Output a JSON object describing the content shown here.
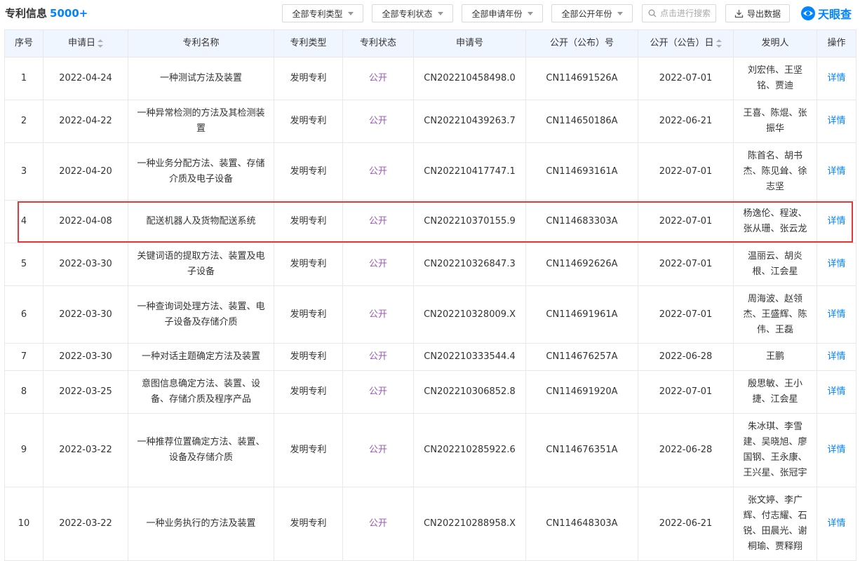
{
  "header": {
    "title": "专利信息",
    "count": "5000+",
    "filters": [
      {
        "label": "全部专利类型",
        "name": "filter-patent-type"
      },
      {
        "label": "全部专利状态",
        "name": "filter-patent-status"
      },
      {
        "label": "全部申请年份",
        "name": "filter-application-year"
      },
      {
        "label": "全部公开年份",
        "name": "filter-publication-year"
      }
    ],
    "search_placeholder": "点击进行搜索",
    "export_label": "导出数据",
    "logo_text": "天眼查"
  },
  "table": {
    "columns": [
      "序号",
      "申请日",
      "专利名称",
      "专利类型",
      "专利状态",
      "申请号",
      "公开（公布）号",
      "公开（公告）日",
      "发明人",
      "操作"
    ],
    "rows": [
      {
        "index": "1",
        "date": "2022-04-24",
        "name": "一种测试方法及装置",
        "type": "发明专利",
        "status": "公开",
        "app_no": "CN202210458498.0",
        "pub_no": "CN114691526A",
        "pub_date": "2022-07-01",
        "inventors": "刘宏伟、王坚铭、贾迪",
        "action": "详情"
      },
      {
        "index": "2",
        "date": "2022-04-22",
        "name": "一种异常检测的方法及其检测装置",
        "type": "发明专利",
        "status": "公开",
        "app_no": "CN202210439263.7",
        "pub_no": "CN114650186A",
        "pub_date": "2022-06-21",
        "inventors": "王喜、陈焜、张振华",
        "action": "详情"
      },
      {
        "index": "3",
        "date": "2022-04-20",
        "name": "一种业务分配方法、装置、存储介质及电子设备",
        "type": "发明专利",
        "status": "公开",
        "app_no": "CN202210417747.1",
        "pub_no": "CN114693161A",
        "pub_date": "2022-07-01",
        "inventors": "陈首名、胡书杰、陈见耸、徐志坚",
        "action": "详情"
      },
      {
        "index": "4",
        "date": "2022-04-08",
        "name": "配送机器人及货物配送系统",
        "type": "发明专利",
        "status": "公开",
        "app_no": "CN202210370155.9",
        "pub_no": "CN114683303A",
        "pub_date": "2022-07-01",
        "inventors": "杨逸伦、程波、张从珊、张云龙",
        "action": "详情"
      },
      {
        "index": "5",
        "date": "2022-03-30",
        "name": "关键词语的提取方法、装置及电子设备",
        "type": "发明专利",
        "status": "公开",
        "app_no": "CN202210326847.3",
        "pub_no": "CN114692626A",
        "pub_date": "2022-07-01",
        "inventors": "温丽云、胡炎根、江会星",
        "action": "详情"
      },
      {
        "index": "6",
        "date": "2022-03-30",
        "name": "一种查询词处理方法、装置、电子设备及存储介质",
        "type": "发明专利",
        "status": "公开",
        "app_no": "CN202210328009.X",
        "pub_no": "CN114691961A",
        "pub_date": "2022-07-01",
        "inventors": "周海波、赵领杰、王盛辉、陈伟、王磊",
        "action": "详情"
      },
      {
        "index": "7",
        "date": "2022-03-30",
        "name": "一种对话主题确定方法及装置",
        "type": "发明专利",
        "status": "公开",
        "app_no": "CN202210333544.4",
        "pub_no": "CN114676257A",
        "pub_date": "2022-06-28",
        "inventors": "王鹏",
        "action": "详情"
      },
      {
        "index": "8",
        "date": "2022-03-25",
        "name": "意图信息确定方法、装置、设备、存储介质及程序产品",
        "type": "发明专利",
        "status": "公开",
        "app_no": "CN202210306852.8",
        "pub_no": "CN114691920A",
        "pub_date": "2022-07-01",
        "inventors": "殷思敏、王小捷、江会星",
        "action": "详情"
      },
      {
        "index": "9",
        "date": "2022-03-22",
        "name": "一种推荐位置确定方法、装置、设备及存储介质",
        "type": "发明专利",
        "status": "公开",
        "app_no": "CN202210285922.6",
        "pub_no": "CN114676351A",
        "pub_date": "2022-06-28",
        "inventors": "朱冰琪、李雪建、吴晓旭、廖国钢、王永康、王兴星、张冠宇",
        "action": "详情"
      },
      {
        "index": "10",
        "date": "2022-03-22",
        "name": "一种业务执行的方法及装置",
        "type": "发明专利",
        "status": "公开",
        "app_no": "CN202210288958.X",
        "pub_no": "CN114648303A",
        "pub_date": "2022-06-21",
        "inventors": "张文婷、李广辉、付志耀、石锐、田晨光、谢桐瑜、贾释翔",
        "action": "详情"
      }
    ]
  },
  "colors": {
    "accent": "#0084ff",
    "status": "#9b59b6",
    "header_bg": "#f0f6ff",
    "highlight": "#e03a3a"
  }
}
